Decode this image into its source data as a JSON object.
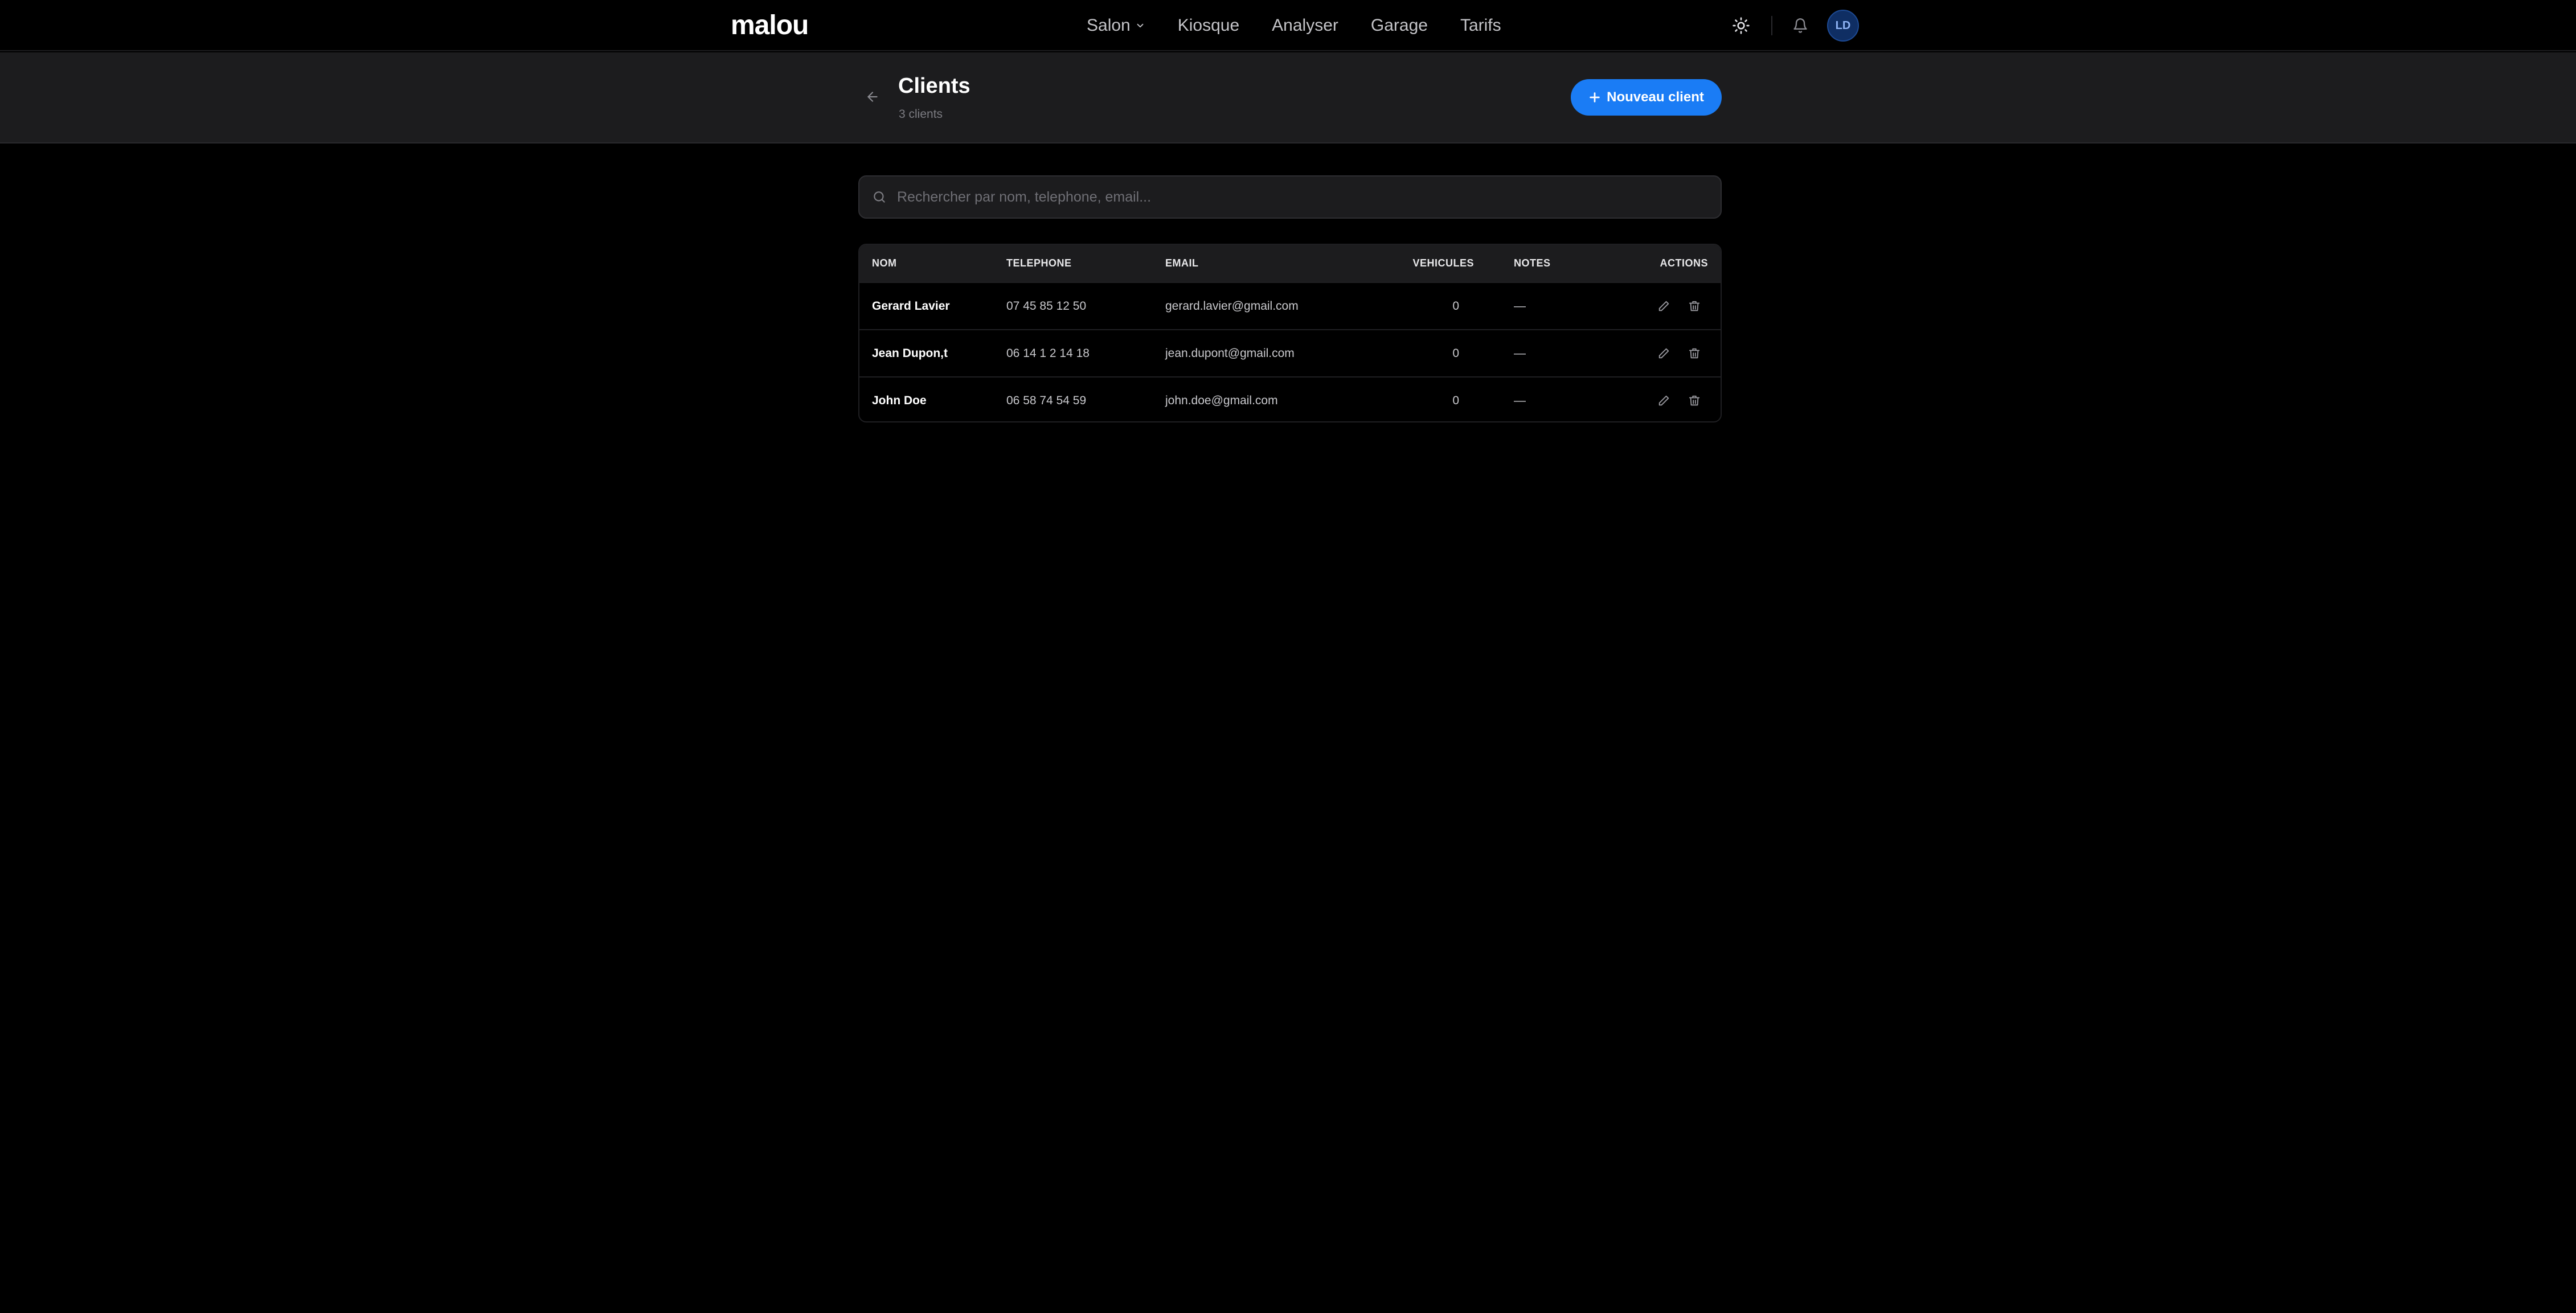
{
  "nav": {
    "logo": "malou",
    "links": [
      {
        "label": "Salon",
        "has_dropdown": true
      },
      {
        "label": "Kiosque"
      },
      {
        "label": "Analyser"
      },
      {
        "label": "Garage"
      },
      {
        "label": "Tarifs"
      }
    ],
    "theme_icon": "sun-icon",
    "notification_icon": "bell-icon",
    "avatar_initials": "LD"
  },
  "header": {
    "title": "Clients",
    "subtitle": "3 clients",
    "new_button_label": "Nouveau client"
  },
  "search": {
    "placeholder": "Rechercher par nom, telephone, email...",
    "value": ""
  },
  "table": {
    "columns": [
      "NOM",
      "TELEPHONE",
      "EMAIL",
      "VEHICULES",
      "NOTES",
      "ACTIONS"
    ],
    "rows": [
      {
        "nom": "Gerard Lavier",
        "telephone": "07 45 85 12 50",
        "email": "gerard.lavier@gmail.com",
        "vehicules": "0",
        "notes": "—"
      },
      {
        "nom": "Jean Dupon,t",
        "telephone": "06 14 1 2 14 18",
        "email": "jean.dupont@gmail.com",
        "vehicules": "0",
        "notes": "—"
      },
      {
        "nom": "John Doe",
        "telephone": "06 58 74 54 59",
        "email": "john.doe@gmail.com",
        "vehicules": "0",
        "notes": "—"
      }
    ]
  },
  "colors": {
    "background": "#000000",
    "header_band": "#1c1c1e",
    "accent": "#1a7cf5",
    "avatar_bg": "#0f2e63"
  }
}
